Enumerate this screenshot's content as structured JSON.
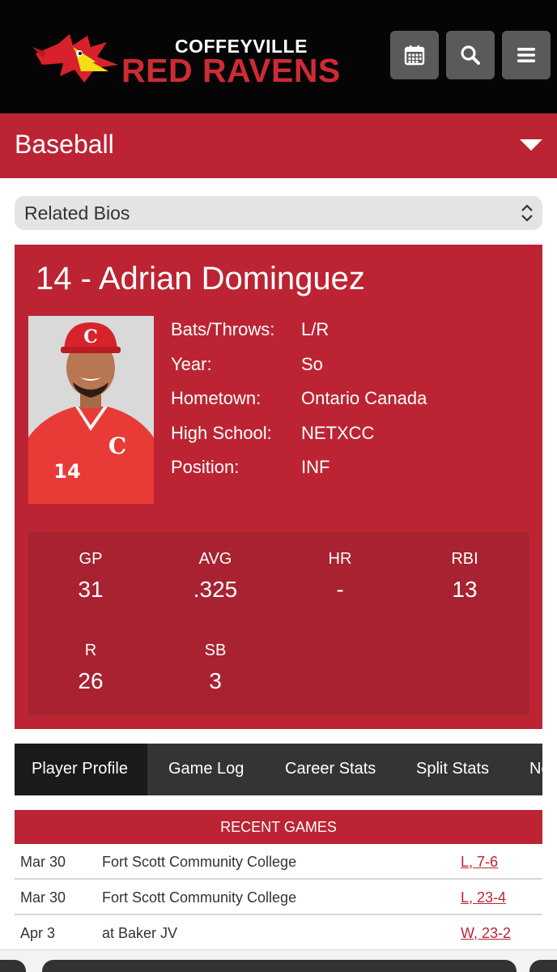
{
  "header": {
    "brand_top": "COFFEYVILLE",
    "brand_bottom": "RED RAVENS",
    "buttons": [
      {
        "icon": "calendar-icon"
      },
      {
        "icon": "search-icon"
      },
      {
        "icon": "menu-icon"
      }
    ],
    "colors": {
      "bar": "#050505",
      "button": "#5a5a5a",
      "brand_red": "#cf2a35"
    }
  },
  "sport_nav": {
    "label": "Baseball",
    "icon": "caret-down-icon",
    "color": "#bc2433"
  },
  "related_bios": {
    "selected": "Related Bios",
    "icon": "select-arrows-icon"
  },
  "player": {
    "heading": "14 - Adrian Dominguez",
    "facts": [
      {
        "label": "Bats/Throws:",
        "value": "L/R"
      },
      {
        "label": "Year:",
        "value": "So"
      },
      {
        "label": "Hometown:",
        "value": "Ontario Canada"
      },
      {
        "label": "High School:",
        "value": "NETXCC"
      },
      {
        "label": "Position:",
        "value": "INF"
      }
    ],
    "stats": [
      {
        "label": "GP",
        "value": "31"
      },
      {
        "label": "AVG",
        "value": ".325"
      },
      {
        "label": "HR",
        "value": "-"
      },
      {
        "label": "RBI",
        "value": "13"
      },
      {
        "label": "R",
        "value": "26"
      },
      {
        "label": "SB",
        "value": "3"
      }
    ]
  },
  "tabs": [
    {
      "label": "Player Profile",
      "active": true
    },
    {
      "label": "Game Log",
      "active": false
    },
    {
      "label": "Career Stats",
      "active": false
    },
    {
      "label": "Split Stats",
      "active": false
    },
    {
      "label": "News",
      "active": false
    }
  ],
  "recent_games": {
    "title": "RECENT GAMES",
    "rows": [
      {
        "date": "Mar 30",
        "opponent": "Fort Scott Community College",
        "result": "L, 7-6"
      },
      {
        "date": "Mar 30",
        "opponent": "Fort Scott Community College",
        "result": "L, 23-4"
      },
      {
        "date": "Apr 3",
        "opponent": "at Baker JV",
        "result": "W, 23-2"
      }
    ]
  }
}
